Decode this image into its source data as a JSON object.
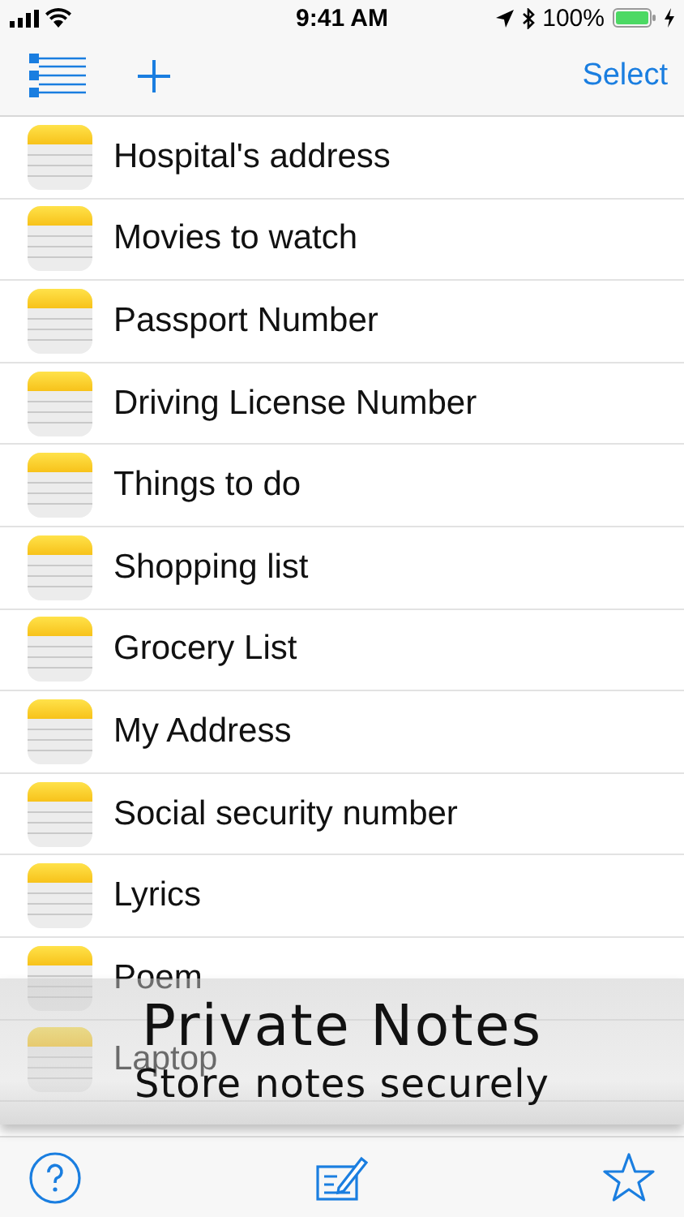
{
  "status_bar": {
    "time": "9:41 AM",
    "battery": "100%"
  },
  "nav_bar": {
    "action": "Select"
  },
  "notes": [
    {
      "title": "Hospital's address"
    },
    {
      "title": "Movies to watch"
    },
    {
      "title": "Passport Number"
    },
    {
      "title": "Driving License Number"
    },
    {
      "title": "Things to do"
    },
    {
      "title": "Shopping list"
    },
    {
      "title": "Grocery List"
    },
    {
      "title": "My Address"
    },
    {
      "title": "Social security number"
    },
    {
      "title": "Lyrics"
    },
    {
      "title": "Poem"
    },
    {
      "title": "Laptop"
    }
  ],
  "banner": {
    "title": "Private Notes",
    "subtitle": "Store notes securely"
  }
}
